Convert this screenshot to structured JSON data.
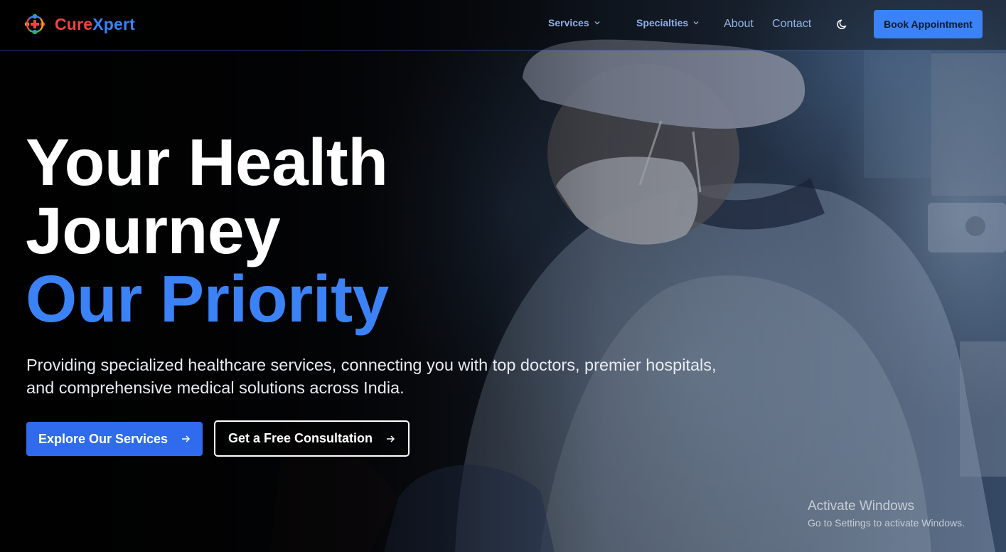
{
  "brand": {
    "name_part1": "Cure",
    "name_part2": "Xpert",
    "color_part1": "#ef4444",
    "color_part2": "#3b82f6",
    "logo_icon": "medical-people-cross-icon"
  },
  "nav": {
    "services_label": "Services",
    "specialties_label": "Specialties",
    "about_label": "About",
    "contact_label": "Contact",
    "theme_icon": "moon-icon",
    "book_label": "Book Appointment"
  },
  "hero": {
    "headline_line1": "Your Health",
    "headline_line2": "Journey",
    "headline_line3": "Our Priority",
    "subtext": "Providing specialized healthcare services, connecting you with top doctors, premier hospitals, and comprehensive medical solutions across India.",
    "primary_cta": "Explore Our Services",
    "secondary_cta": "Get a Free Consultation",
    "cta_icon": "arrow-right-icon",
    "background_image": "surgeon-in-operating-room-photo"
  },
  "watermark": {
    "title": "Activate Windows",
    "subtitle": "Go to Settings to activate Windows."
  },
  "colors": {
    "accent": "#3b82f6",
    "primary_button": "#2f6bec",
    "nav_text": "#93b4e6"
  }
}
